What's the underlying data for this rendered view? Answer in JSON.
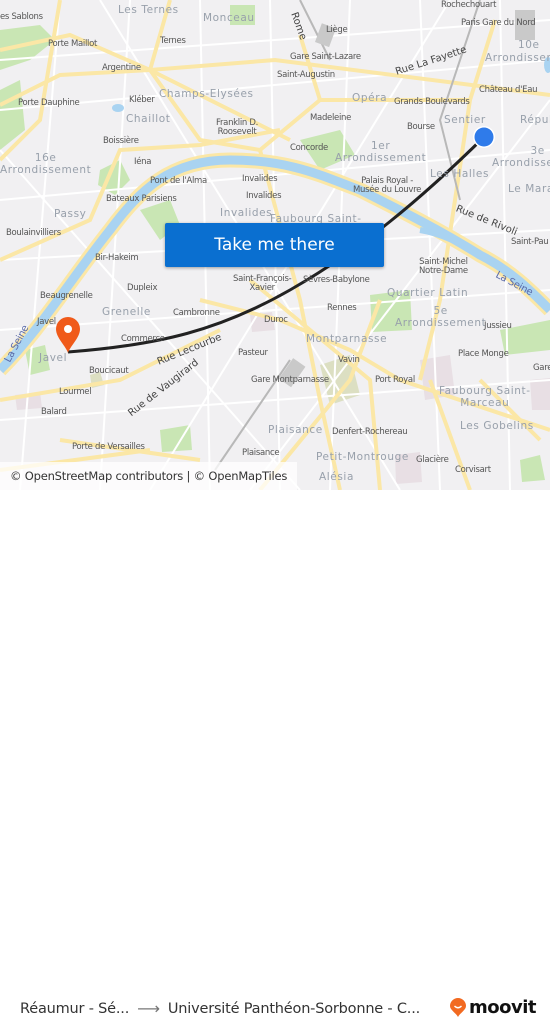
{
  "map": {
    "labels": {
      "sablons": "es Sablons",
      "les_ternes": "Les Ternes",
      "monceau": "Monceau",
      "rome": "Rome",
      "liege": "Liège",
      "rochechouart": "Rochechouart",
      "gare_du_nord": "Paris Gare du Nord",
      "arr10_num": "10e",
      "arr10_word": "Arrondissem",
      "porte_maillot": "Porte Maillot",
      "ternes": "Ternes",
      "gare_st_lazare": "Gare Saint-Lazare",
      "rue_la_fayette": "Rue La Fayette",
      "argentine": "Argentine",
      "saint_augustin": "Saint-Augustin",
      "chateau_deau": "Château d'Eau",
      "champs_elysees": "Champs-Elysées",
      "opera": "Opéra",
      "porte_dauphine": "Porte Dauphine",
      "kleber": "Kléber",
      "grands_boulevards": "Grands Boulevards",
      "chaillot": "Chaillot",
      "franklin": "Franklin D.\nRoosevelt",
      "madeleine": "Madeleine",
      "sentier": "Sentier",
      "bourse": "Bourse",
      "republique": "Répub",
      "boissiere": "Boissière",
      "concorde": "Concorde",
      "arr1": "1er\nArrondissement",
      "arr3": "3e\nArrondissement",
      "arr16": "16e\nArrondissement",
      "iena": "Iéna",
      "les_halles": "Les Halles",
      "palais_royal": "Palais Royal -\nMusée du Louvre",
      "le_marais": "Le Mara",
      "pont_alma": "Pont de l'Alma",
      "invalides_1": "Invalides",
      "invalides_2": "Invalides",
      "invalides_district": "Invalides",
      "bateaux": "Bateaux Parisiens",
      "passy": "Passy",
      "rue_de_rivoli": "Rue de Rivoli",
      "faubourg_st_germain": "Faubourg Saint-",
      "boulainvilliers": "Boulainvilliers",
      "saint_paul": "Saint-Pau",
      "bir_hakeim": "Bir-Hakeim",
      "st_michel": "Saint-Michel\nNotre-Dame",
      "la_seine_east": "La Seine",
      "st_francois": "Saint-François-\nXavier",
      "sevres": "Sèvres-Babylone",
      "dupleix": "Dupleix",
      "quartier_latin": "Quartier Latin",
      "beaugrenelle": "Beaugrenelle",
      "grenelle": "Grenelle",
      "javel_station": "Javel",
      "cambronne": "Cambronne",
      "rennes": "Rennes",
      "arr5": "5e\nArrondissement",
      "jussieu": "Jussieu",
      "la_seine_west": "La Seine",
      "duroc": "Duroc",
      "montparnasse": "Montparnasse",
      "commerce": "Commerce",
      "rue_lecourbe": "Rue Lecourbe",
      "javel_district": "Javel",
      "pasteur": "Pasteur",
      "place_monge": "Place Monge",
      "vavin": "Vavin",
      "boucicaut": "Boucicaut",
      "rue_vaugirard": "Rue de Vaugirard",
      "gare_montparnasse": "Gare Montparnasse",
      "port_royal": "Port Royal",
      "faubourg_st_marceau": "Faubourg Saint-\nMarceau",
      "gare_e": "Gare",
      "lourmel": "Lourmel",
      "balard": "Balard",
      "plaisance_district": "Plaisance",
      "denfert": "Denfert-Rochereau",
      "les_gobelins": "Les Gobelins",
      "porte_versailles": "Porte de Versailles",
      "plaisance": "Plaisance",
      "petit_montrouge": "Petit-Montrouge",
      "glaciere": "Glacière",
      "corvisart": "Corvisart",
      "alesia": "Alésia"
    },
    "origin_marker": {
      "icon": "origin-dot-icon",
      "color": "#2f7bea"
    },
    "destination_marker": {
      "icon": "map-pin-icon",
      "color": "#f05a1a"
    },
    "route_line_color": "#222222"
  },
  "cta": {
    "label": "Take me there",
    "color": "#0a6fd0"
  },
  "attribution": "© OpenStreetMap contributors | © OpenMapTiles",
  "footer": {
    "origin": "Réaumur - Sé...",
    "arrow_icon": "arrow-right-icon",
    "destination": "Université Panthéon-Sorbonne - C...",
    "brand": "moovit",
    "brand_color": "#f26a21"
  }
}
